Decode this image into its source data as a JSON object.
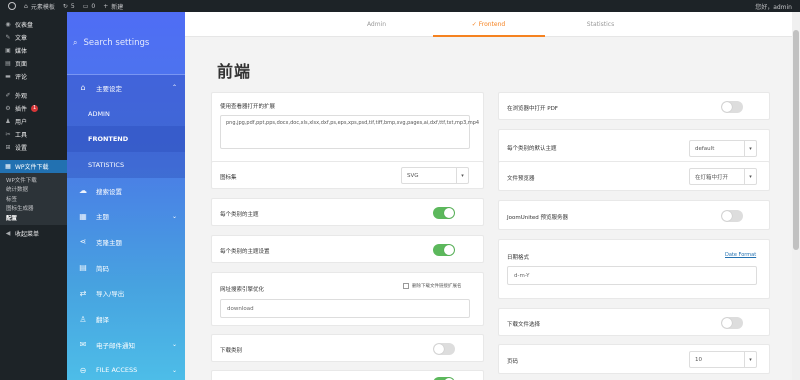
{
  "adminbar": {
    "site_name": "元素模板",
    "updates_count": "5",
    "comments_count": "0",
    "new_label": "新建",
    "greeting": "您好，admin"
  },
  "wp_menu": {
    "items": [
      {
        "icon": "dashboard-icon",
        "glyph": "◉",
        "label": "仪表盘"
      },
      {
        "icon": "pin-icon",
        "glyph": "✎",
        "label": "文章"
      },
      {
        "icon": "media-icon",
        "glyph": "▣",
        "label": "媒体"
      },
      {
        "icon": "page-icon",
        "glyph": "▤",
        "label": "页面"
      },
      {
        "icon": "comment-icon",
        "glyph": "▬",
        "label": "评论"
      },
      {
        "icon": "appearance-icon",
        "glyph": "✐",
        "label": "外观"
      },
      {
        "icon": "plugins-icon",
        "glyph": "⚙",
        "label": "插件",
        "badge": "1"
      },
      {
        "icon": "users-icon",
        "glyph": "♟",
        "label": "用户"
      },
      {
        "icon": "tools-icon",
        "glyph": "✂",
        "label": "工具"
      },
      {
        "icon": "settings-icon",
        "glyph": "⊞",
        "label": "设置"
      }
    ],
    "active": {
      "icon": "folder-icon",
      "glyph": "▦",
      "label": "WP文件下载"
    },
    "submenu": [
      "WP文件下载",
      "统计数据",
      "标签",
      "图标生成器",
      "配置"
    ],
    "collapse": {
      "glyph": "◀",
      "label": "收起菜单"
    }
  },
  "plugin_sidebar": {
    "search_placeholder": "Search settings",
    "main_settings": "主要设定",
    "subs": [
      "ADMIN",
      "FRONTEND",
      "STATISTICS"
    ],
    "rows": [
      {
        "name": "search-settings",
        "glyph": "☁",
        "label": "搜索设置",
        "chev": ""
      },
      {
        "name": "theme",
        "glyph": "▦",
        "label": "主题",
        "chev": "⌄"
      },
      {
        "name": "clone-theme",
        "glyph": "⋖",
        "label": "克隆主题",
        "chev": ""
      },
      {
        "name": "shortcode",
        "glyph": "▤",
        "label": "简码",
        "chev": ""
      },
      {
        "name": "import-export",
        "glyph": "⇄",
        "label": "导入/导出",
        "chev": ""
      },
      {
        "name": "translate",
        "glyph": "♙",
        "label": "翻译",
        "chev": ""
      },
      {
        "name": "email-notify",
        "glyph": "✉",
        "label": "电子邮件通知",
        "chev": "⌄"
      },
      {
        "name": "file-access",
        "glyph": "⊖",
        "label": "FILE ACCESS",
        "chev": "⌄"
      }
    ]
  },
  "tabs": [
    "Admin",
    "Frontend",
    "Statistics"
  ],
  "active_tab_check": "✓",
  "page_title": "前端",
  "left_cards": {
    "ext_label": "使用查看器打开的扩展",
    "ext_value": "png,jpg,pdf,ppt,pps,docx,doc,xls,xlsx,dxf,ps,eps,xps,psd,tif,tiff,bmp,svg,pages,ai,dxf,ttf,txt,mp3,mp4",
    "iconset_label": "图标集",
    "iconset_value": "SVG",
    "theme_per_category": "每个类别的主题",
    "theme_per_category_on": true,
    "theme_per_category_setting": "每个类别的主题设置",
    "theme_per_category_setting_on": true,
    "url_rewrite_label": "网址搜索引擎优化",
    "url_rewrite_check": "删除下载文件链接扩展名",
    "url_rewrite_value": "download",
    "download_category_label": "下载类别",
    "download_category_on": false
  },
  "right_cards": {
    "open_pdf": "在浏览器中打开 PDF",
    "open_pdf_on": false,
    "default_theme_label": "每个类别的默认主题",
    "default_theme_value": "default",
    "file_preview_label": "文件预览器",
    "file_preview_value": "在灯箱中打开",
    "joomunited_label": "JoomUnited 预览服务器",
    "joomunited_on": false,
    "date_format_label": "日期格式",
    "date_format_link": "Date Format",
    "date_format_value": "d-m-Y",
    "download_select_label": "下载文件选择",
    "download_select_on": false,
    "pagination_label": "页码",
    "pagination_value": "10"
  },
  "colors": {
    "accent": "#f58220",
    "toggle_on": "#5cb85c",
    "wp_blue": "#2271b1"
  }
}
